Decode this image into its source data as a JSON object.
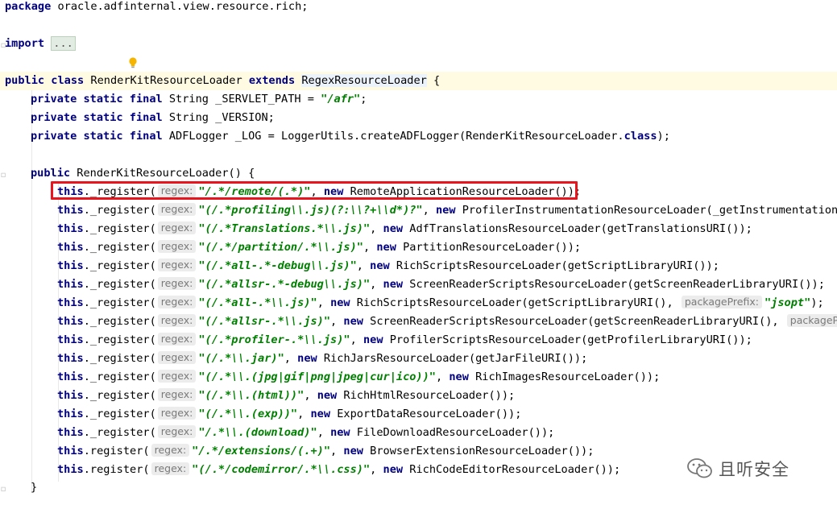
{
  "code": {
    "package_line": {
      "kw": "package",
      "name": " oracle.adfinternal.view.resource.rich;"
    },
    "import_line": {
      "kw": "import",
      "folded": "..."
    },
    "class_line": {
      "kw1": "public",
      "kw2": "class",
      "name": "RenderKitResourceLoader",
      "kw3": "extends",
      "parent": "RegexResourceLoader",
      "brace": "{"
    },
    "fields": [
      {
        "mods": "private static final",
        "type": " String ",
        "name": "_SERVLET_PATH",
        "assign": " = ",
        "value": "\"/afr\"",
        "end": ";"
      },
      {
        "mods": "private static final",
        "type": " String ",
        "name": "_VERSION",
        "assign": "",
        "value": "",
        "end": ";"
      },
      {
        "mods": "private static final",
        "type": " ADFLogger ",
        "name": "_LOG",
        "assign": " = LoggerUtils.createADFLogger(RenderKitResourceLoader.",
        "value": "class",
        "end": ");"
      }
    ],
    "ctor_line": {
      "kw": "public",
      "name": " RenderKitResourceLoader() {"
    },
    "hint_label": "regex:",
    "hint_label2": "packagePrefix:",
    "calls": [
      {
        "this": "this",
        "method": "._register(",
        "regex": "\"/.*/remote/(.*)\"",
        "kw_new": "new",
        "rest": " RemoteApplicationResourceLoader());"
      },
      {
        "this": "this",
        "method": "._register(",
        "regex": "\"(/.*profiling\\\\.js)(?:\\\\?+\\\\d*)?\"",
        "kw_new": "new",
        "rest": " ProfilerInstrumentationResourceLoader(_getInstrumentationURI"
      },
      {
        "this": "this",
        "method": "._register(",
        "regex": "\"(/.*Translations.*\\\\.js)\"",
        "kw_new": "new",
        "rest": " AdfTranslationsResourceLoader(getTranslationsURI());"
      },
      {
        "this": "this",
        "method": "._register(",
        "regex": "\"(/.*/partition/.*\\\\.js)\"",
        "kw_new": "new",
        "rest": " PartitionResourceLoader());"
      },
      {
        "this": "this",
        "method": "._register(",
        "regex": "\"(/.*all-.*-debug\\\\.js)\"",
        "kw_new": "new",
        "rest": " RichScriptsResourceLoader(getScriptLibraryURI());"
      },
      {
        "this": "this",
        "method": "._register(",
        "regex": "\"(/.*allsr-.*-debug\\\\.js)\"",
        "kw_new": "new",
        "rest": " ScreenReaderScriptsResourceLoader(getScreenReaderLibraryURI());"
      },
      {
        "this": "this",
        "method": "._register(",
        "regex": "\"(/.*all-.*\\\\.js)\"",
        "kw_new": "new",
        "rest": " RichScriptsResourceLoader(getScriptLibraryURI(), ",
        "extra_hint": true,
        "extra_value": "\"jsopt\"",
        "extra_end": ");"
      },
      {
        "this": "this",
        "method": "._register(",
        "regex": "\"(/.*allsr-.*\\\\.js)\"",
        "kw_new": "new",
        "rest": " ScreenReaderScriptsResourceLoader(getScreenReaderLibraryURI(), ",
        "extra_hint": true,
        "extra_value": "",
        "extra_end": ""
      },
      {
        "this": "this",
        "method": "._register(",
        "regex": "\"(/.*profiler-.*\\\\.js)\"",
        "kw_new": "new",
        "rest": " ProfilerScriptsResourceLoader(getProfilerLibraryURI());"
      },
      {
        "this": "this",
        "method": "._register(",
        "regex": "\"(/.*\\\\.jar)\"",
        "kw_new": "new",
        "rest": " RichJarsResourceLoader(getJarFileURI());"
      },
      {
        "this": "this",
        "method": "._register(",
        "regex": "\"(/.*\\\\.(jpg|gif|png|jpeg|cur|ico))\"",
        "kw_new": "new",
        "rest": " RichImagesResourceLoader());"
      },
      {
        "this": "this",
        "method": "._register(",
        "regex": "\"(/.*\\\\.(html))\"",
        "kw_new": "new",
        "rest": " RichHtmlResourceLoader());"
      },
      {
        "this": "this",
        "method": "._register(",
        "regex": "\"(/.*\\\\.(exp))\"",
        "kw_new": "new",
        "rest": " ExportDataResourceLoader());"
      },
      {
        "this": "this",
        "method": "._register(",
        "regex": "\"/.*\\\\.(download)\"",
        "kw_new": "new",
        "rest": " FileDownloadResourceLoader());"
      },
      {
        "this": "this",
        "method": ".register(",
        "regex": "\"/.*/extensions/(.+)\"",
        "kw_new": "new",
        "rest": " BrowserExtensionResourceLoader());"
      },
      {
        "this": "this",
        "method": ".register(",
        "regex": "\"(/.*/codemirror/.*\\\\.css)\"",
        "kw_new": "new",
        "rest": " RichCodeEditorResourceLoader());"
      }
    ],
    "close_brace": "}"
  },
  "watermark": {
    "text": "且听安全",
    "icon": "wechat-icon"
  },
  "colors": {
    "keyword": "#000080",
    "string": "#008000",
    "highlight_box": "#e8151f",
    "caret_line": "#fffbe3"
  }
}
